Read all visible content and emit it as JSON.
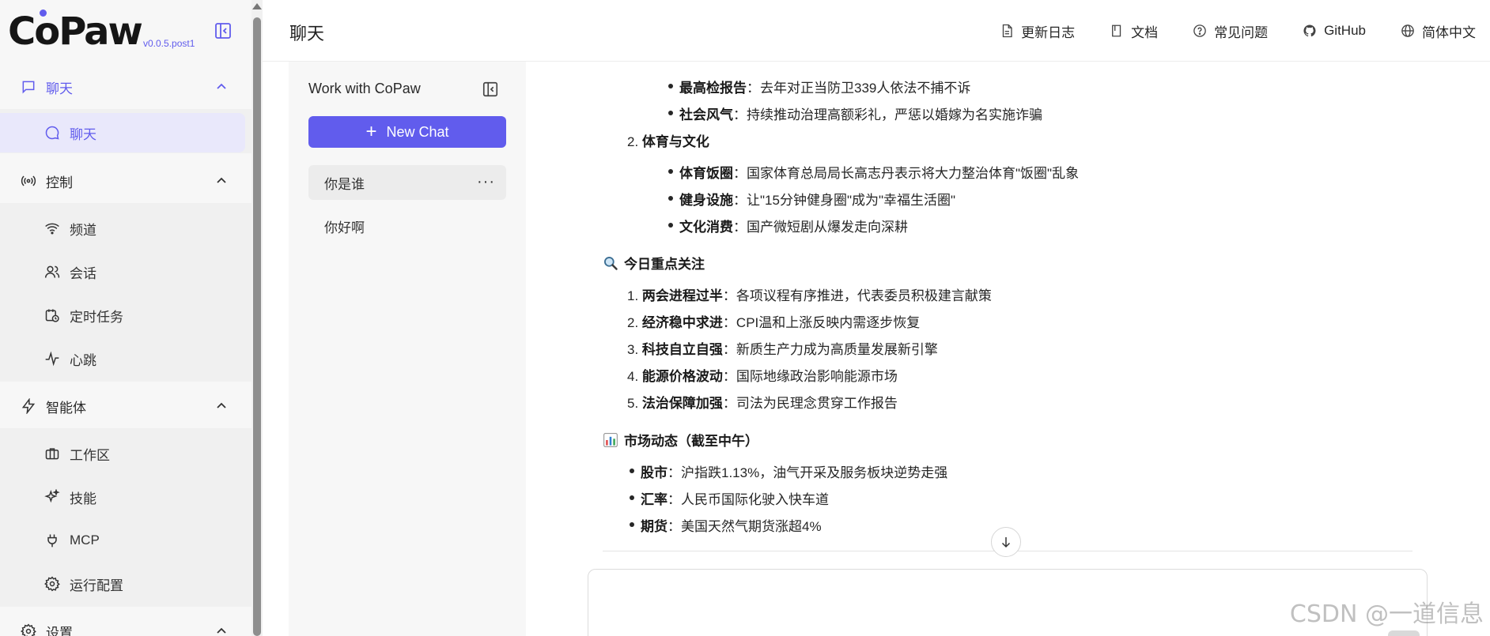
{
  "app": {
    "logo": "CoPaw",
    "version": "v0.0.5.post1"
  },
  "sidebar": {
    "groups": [
      {
        "label": "聊天",
        "icon": "chat-bubble-icon",
        "items": [
          {
            "label": "聊天",
            "icon": "message-circle-icon",
            "selected": true
          }
        ]
      },
      {
        "label": "控制",
        "icon": "broadcast-icon",
        "items": [
          {
            "label": "频道",
            "icon": "wifi-icon"
          },
          {
            "label": "会话",
            "icon": "users-icon"
          },
          {
            "label": "定时任务",
            "icon": "calendar-clock-icon"
          },
          {
            "label": "心跳",
            "icon": "heartbeat-icon"
          }
        ]
      },
      {
        "label": "智能体",
        "icon": "lightning-icon",
        "items": [
          {
            "label": "工作区",
            "icon": "briefcase-icon"
          },
          {
            "label": "技能",
            "icon": "sparkles-icon"
          },
          {
            "label": "MCP",
            "icon": "plug-icon"
          },
          {
            "label": "运行配置",
            "icon": "gear-icon"
          }
        ]
      },
      {
        "label": "设置",
        "icon": "settings-icon",
        "items": []
      }
    ]
  },
  "header": {
    "title": "聊天",
    "links": [
      {
        "label": "更新日志",
        "icon": "document-icon"
      },
      {
        "label": "文档",
        "icon": "book-icon"
      },
      {
        "label": "常见问题",
        "icon": "question-circle-icon"
      },
      {
        "label": "GitHub",
        "icon": "github-icon"
      },
      {
        "label": "简体中文",
        "icon": "globe-icon"
      }
    ]
  },
  "sessions_panel": {
    "title": "Work with CoPaw",
    "new_chat_label": "New Chat",
    "sessions": [
      {
        "label": "你是谁",
        "active": true
      },
      {
        "label": "你好啊",
        "active": false
      }
    ]
  },
  "chat": {
    "lines": {
      "b1_label": "最高检报告",
      "b1_text": "：去年对正当防卫339人依法不捕不诉",
      "b2_label": "社会风气",
      "b2_text": "：持续推动治理高额彩礼，严惩以婚嫁为名实施诈骗",
      "n2_num": "2.",
      "n2_title": "体育与文化",
      "c1_label": "体育饭圈",
      "c1_text": "：国家体育总局局长高志丹表示将大力整治体育\"饭圈\"乱象",
      "c2_label": "健身设施",
      "c2_text": "：让\"15分钟健身圈\"成为\"幸福生活圈\"",
      "c3_label": "文化消费",
      "c3_text": "：国产微短剧从爆发走向深耕"
    },
    "focus_title": "今日重点关注",
    "focus_items": [
      {
        "num": "1.",
        "label": "两会进程过半",
        "text": "：各项议程有序推进，代表委员积极建言献策"
      },
      {
        "num": "2.",
        "label": "经济稳中求进",
        "text": "：CPI温和上涨反映内需逐步恢复"
      },
      {
        "num": "3.",
        "label": "科技自立自强",
        "text": "：新质生产力成为高质量发展新引擎"
      },
      {
        "num": "4.",
        "label": "能源价格波动",
        "text": "：国际地缘政治影响能源市场"
      },
      {
        "num": "5.",
        "label": "法治保障加强",
        "text": "：司法为民理念贯穿工作报告"
      }
    ],
    "market_title": "市场动态（截至中午）",
    "market_items": [
      {
        "label": "股市",
        "text": "：沪指跌1.13%，油气开采及服务板块逆势走强"
      },
      {
        "label": "汇率",
        "text": "：人民币国际化驶入快车道"
      },
      {
        "label": "期货",
        "text": "：美国天然气期货涨超4%"
      }
    ]
  },
  "watermark": "CSDN @一道信息",
  "colors": {
    "accent": "#615ced",
    "selected_bg": "#e9e8fb"
  }
}
